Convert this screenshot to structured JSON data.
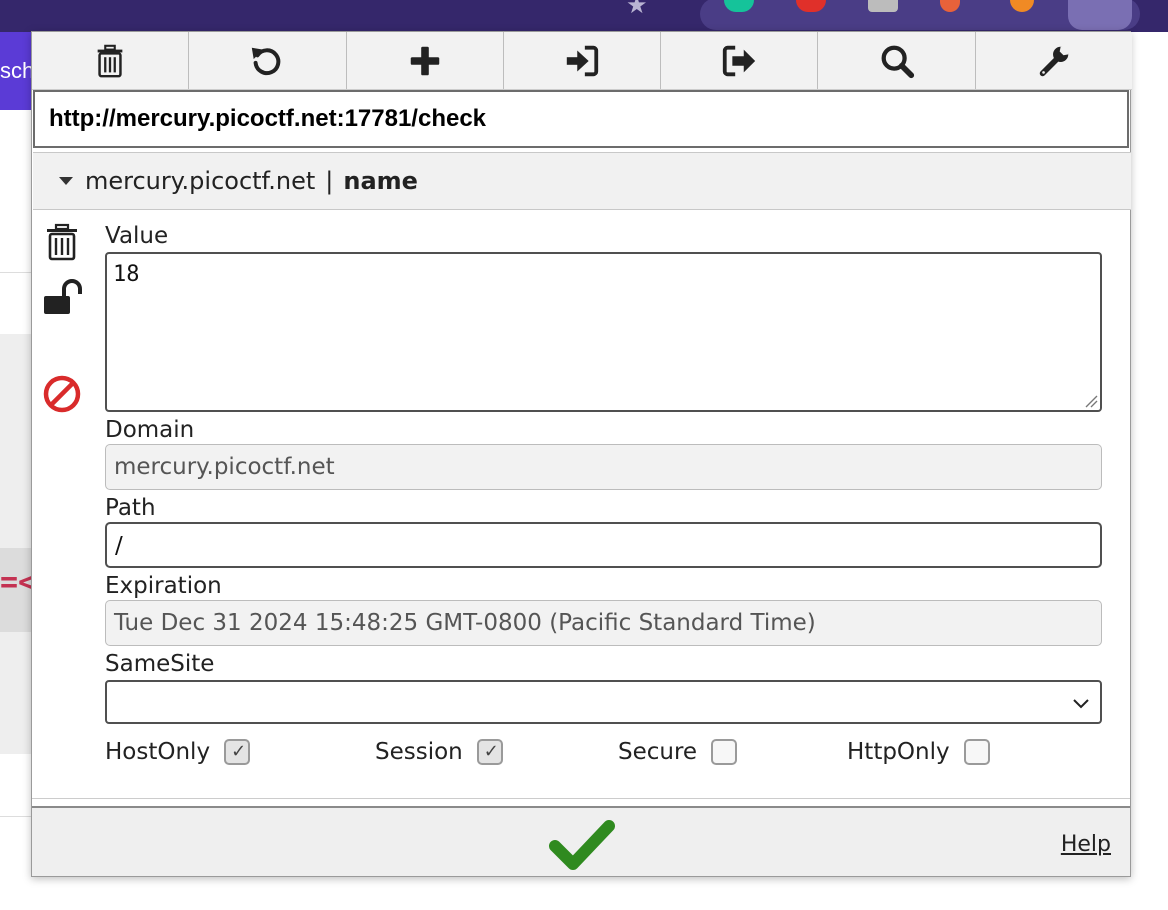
{
  "background": {
    "page_header_text": "sch",
    "code_fragment": "=<"
  },
  "toolbar": {
    "buttons": [
      {
        "icon": "trash-icon"
      },
      {
        "icon": "undo-icon"
      },
      {
        "icon": "plus-icon"
      },
      {
        "icon": "import-icon"
      },
      {
        "icon": "export-icon"
      },
      {
        "icon": "search-icon"
      },
      {
        "icon": "wrench-icon"
      }
    ]
  },
  "url": "http://mercury.picoctf.net:17781/check",
  "cookie": {
    "domain_label": "mercury.picoctf.net",
    "separator": "|",
    "name": "name"
  },
  "form": {
    "value_label": "Value",
    "value": "18",
    "domain_label": "Domain",
    "domain": "mercury.picoctf.net",
    "path_label": "Path",
    "path": "/",
    "expiration_label": "Expiration",
    "expiration": "Tue Dec 31 2024 15:48:25 GMT-0800 (Pacific Standard Time)",
    "samesite_label": "SameSite",
    "samesite": "",
    "flags": {
      "hostonly_label": "HostOnly",
      "hostonly": true,
      "session_label": "Session",
      "session": true,
      "secure_label": "Secure",
      "secure": false,
      "httponly_label": "HttpOnly",
      "httponly": false
    }
  },
  "footer": {
    "help_label": "Help"
  },
  "colors": {
    "browser_bar": "#35276b",
    "save_green": "#2f8a1f",
    "block_red": "#d92b2b"
  }
}
